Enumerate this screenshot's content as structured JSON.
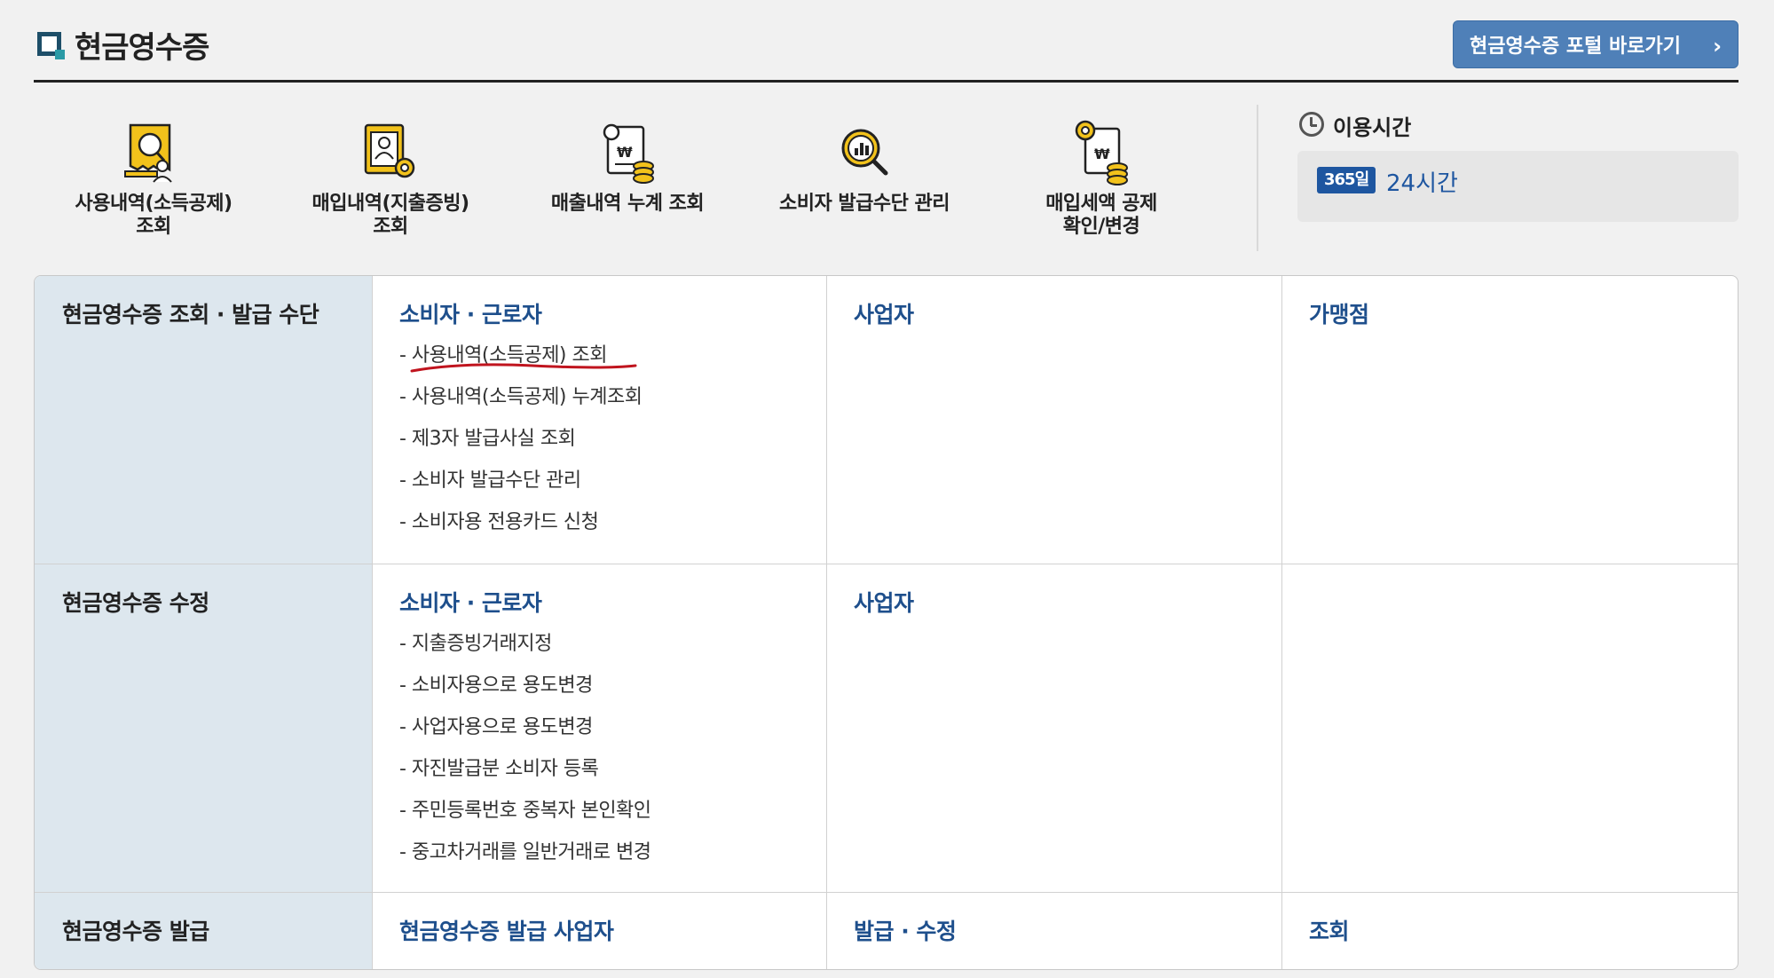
{
  "header": {
    "title": "현금영수증",
    "portal_button": "현금영수증 포털 바로가기",
    "portal_chevron": "›"
  },
  "quick_menu": [
    {
      "label": "사용내역(소득공제)\n조회",
      "icon": "receipt-search-icon"
    },
    {
      "label": "매입내역(지출증빙)\n조회",
      "icon": "document-gear-icon"
    },
    {
      "label": "매출내역 누계 조회",
      "icon": "document-coins-icon"
    },
    {
      "label": "소비자 발급수단 관리",
      "icon": "magnifier-chart-icon"
    },
    {
      "label": "매입세액 공제\n확인/변경",
      "icon": "gear-document-coins-icon"
    }
  ],
  "usage": {
    "title": "이용시간",
    "badge": "365일",
    "value": "24시간"
  },
  "table": {
    "rows": [
      {
        "header": "현금영수증 조회 · 발급 수단",
        "col1": {
          "title": "소비자 · 근로자",
          "links": [
            "- 사용내역(소득공제) 조회",
            "- 사용내역(소득공제) 누계조회",
            "- 제3자 발급사실 조회",
            "- 소비자 발급수단 관리",
            "- 소비자용 전용카드 신청"
          ]
        },
        "col2": {
          "title": "사업자"
        },
        "col3": {
          "title": "가맹점"
        }
      },
      {
        "header": "현금영수증 수정",
        "col1": {
          "title": "소비자 · 근로자",
          "links": [
            "- 지출증빙거래지정",
            "- 소비자용으로 용도변경",
            "- 사업자용으로 용도변경",
            "- 자진발급분 소비자 등록",
            "- 주민등록번호 중복자 본인확인",
            "- 중고차거래를 일반거래로 변경"
          ]
        },
        "col2": {
          "title": "사업자"
        },
        "col3": {
          "title": ""
        }
      },
      {
        "header": "현금영수증 발급",
        "col1": {
          "title": "현금영수증 발급 사업자"
        },
        "col2": {
          "title": "발급 · 수정"
        },
        "col3": {
          "title": "조회"
        }
      }
    ]
  },
  "colors": {
    "accent_blue": "#1e4f8c",
    "button_blue": "#4f80b8",
    "header_cell_bg": "#dde7ee",
    "annotation_red": "#c0141e"
  }
}
